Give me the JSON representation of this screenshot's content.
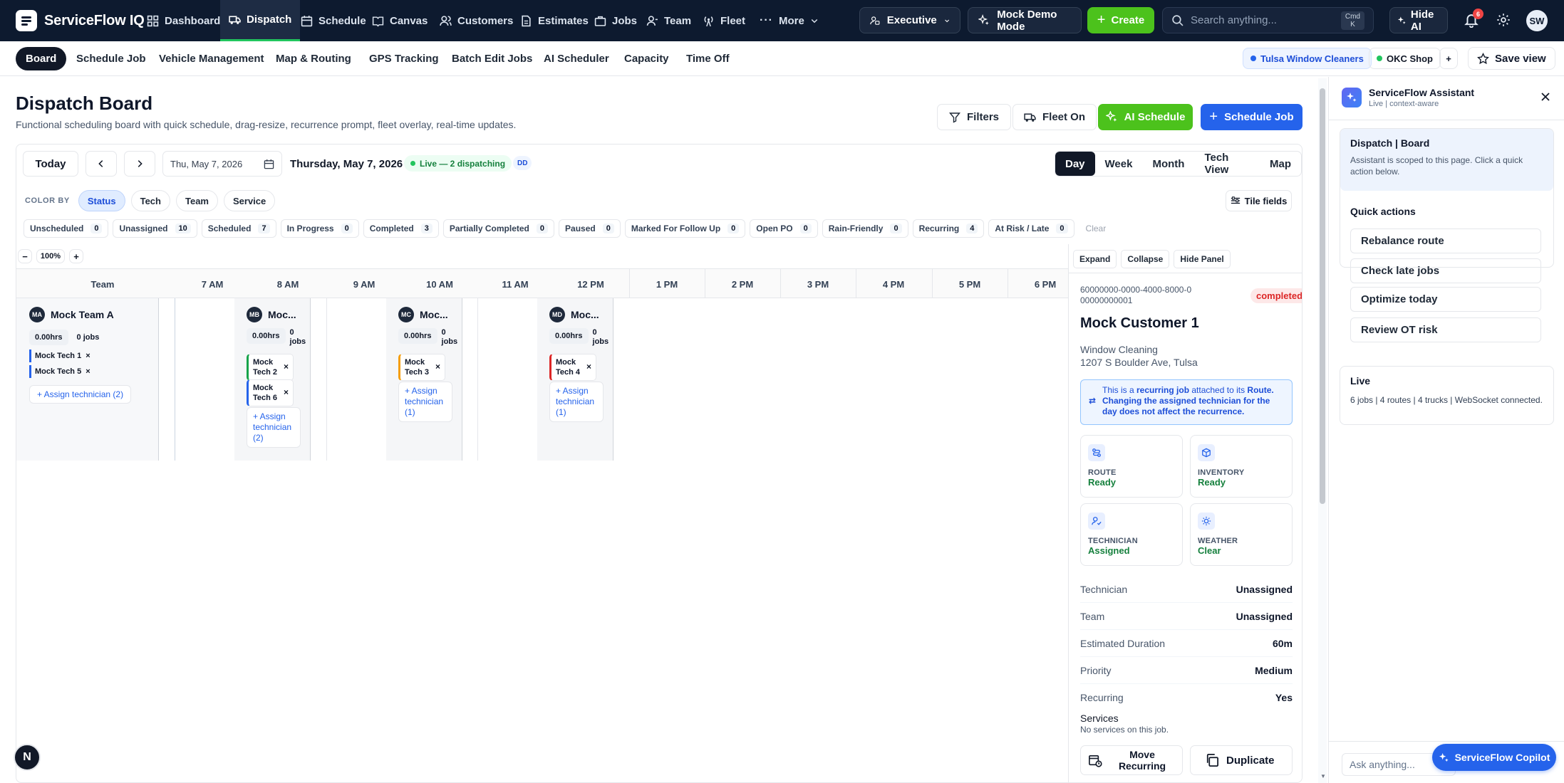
{
  "app": {
    "name": "ServiceFlow IQ"
  },
  "topnav": {
    "items": [
      {
        "label": "Dashboard"
      },
      {
        "label": "Dispatch"
      },
      {
        "label": "Schedule"
      },
      {
        "label": "Canvas"
      },
      {
        "label": "Customers"
      },
      {
        "label": "Estimates"
      },
      {
        "label": "Jobs"
      },
      {
        "label": "Team"
      },
      {
        "label": "Fleet"
      },
      {
        "label": "More"
      }
    ],
    "role": "Executive",
    "demo_mode": "Mock Demo Mode",
    "create": "Create",
    "search_placeholder": "Search anything...",
    "search_kbd_1": "Cmd",
    "search_kbd_2": "K",
    "hide_ai": "Hide AI",
    "notifications": "6",
    "avatar": "SW"
  },
  "subnav": {
    "items": [
      {
        "label": "Board"
      },
      {
        "label": "Schedule Job"
      },
      {
        "label": "Vehicle Management"
      },
      {
        "label": "Map & Routing"
      },
      {
        "label": "GPS Tracking"
      },
      {
        "label": "Batch Edit Jobs"
      },
      {
        "label": "AI Scheduler"
      },
      {
        "label": "Capacity"
      },
      {
        "label": "Time Off"
      }
    ],
    "org1": "Tulsa Window Cleaners",
    "org2": "OKC Shop",
    "plus": "+",
    "save_view": "Save view"
  },
  "header": {
    "title": "Dispatch Board",
    "subtitle": "Functional scheduling board with quick schedule, drag-resize, recurrence prompt, fleet overlay, real-time updates.",
    "filters": "Filters",
    "fleet": "Fleet On",
    "ai_schedule": "AI Schedule",
    "schedule_job": "Schedule Job"
  },
  "board": {
    "today": "Today",
    "date_input": "Thu, May 7, 2026",
    "date_long": "Thursday, May 7, 2026",
    "live": "Live — 2 dispatching",
    "dd": "DD",
    "views": [
      {
        "label": "Day"
      },
      {
        "label": "Week"
      },
      {
        "label": "Month"
      },
      {
        "label": "Tech View"
      },
      {
        "label": "Map"
      }
    ],
    "color_by_label": "COLOR BY",
    "color_by": [
      {
        "label": "Status"
      },
      {
        "label": "Tech"
      },
      {
        "label": "Team"
      },
      {
        "label": "Service"
      }
    ],
    "tile_fields": "Tile fields",
    "statuses": [
      {
        "label": "Unscheduled",
        "count": "0"
      },
      {
        "label": "Unassigned",
        "count": "10"
      },
      {
        "label": "Scheduled",
        "count": "7"
      },
      {
        "label": "In Progress",
        "count": "0"
      },
      {
        "label": "Completed",
        "count": "3"
      },
      {
        "label": "Partially Completed",
        "count": "0"
      },
      {
        "label": "Paused",
        "count": "0"
      },
      {
        "label": "Marked For Follow Up",
        "count": "0"
      },
      {
        "label": "Open PO",
        "count": "0"
      },
      {
        "label": "Rain-Friendly",
        "count": "0"
      },
      {
        "label": "Recurring",
        "count": "4"
      },
      {
        "label": "At Risk / Late",
        "count": "0"
      }
    ],
    "clear": "Clear",
    "zoom": "100%",
    "zoom_minus": "−",
    "zoom_plus": "+",
    "team_header": "Team",
    "hours": [
      "7 AM",
      "8 AM",
      "9 AM",
      "10 AM",
      "11 AM",
      "12 PM",
      "1 PM",
      "2 PM",
      "3 PM",
      "4 PM",
      "5 PM",
      "6 PM"
    ],
    "team_a": {
      "initials": "MA",
      "name": "Mock Team A",
      "hours": "0.00hrs",
      "jobs": "0 jobs",
      "techs": [
        "Mock Tech 1",
        "Mock Tech 5"
      ],
      "assign": "+ Assign technician (2)"
    },
    "team_b": {
      "initials": "MB",
      "name": "Moc...",
      "hours": "0.00hrs",
      "jobs": "0 jobs",
      "tech1": "Mock Tech 2",
      "tech2": "Mock Tech 6",
      "assign": "+ Assign technician (2)"
    },
    "team_c": {
      "initials": "MC",
      "name": "Moc...",
      "hours": "0.00hrs",
      "jobs": "0 jobs",
      "tech1": "Mock Tech 3",
      "assign": "+ Assign technician (1)"
    },
    "team_d": {
      "initials": "MD",
      "name": "Moc...",
      "hours": "0.00hrs",
      "jobs": "0 jobs",
      "tech1": "Mock Tech 4",
      "assign": "+ Assign technician (1)"
    }
  },
  "detail": {
    "expand": "Expand",
    "collapse": "Collapse",
    "hide": "Hide Panel",
    "job_id": "60000000-0000-4000-8000-000000000001",
    "status": "completed",
    "customer": "Mock Customer 1",
    "service": "Window Cleaning",
    "address": "1207 S Boulder Ave, Tulsa",
    "notice_pre": "This is a ",
    "notice_bold": "recurring job",
    "notice_mid": " attached to its ",
    "notice_bold2": "Route",
    "notice_post": ". Changing the assigned technician for the day does not affect the recurrence.",
    "cards": [
      {
        "title": "ROUTE",
        "value": "Ready"
      },
      {
        "title": "INVENTORY",
        "value": "Ready"
      },
      {
        "title": "TECHNICIAN",
        "value": "Assigned"
      },
      {
        "title": "WEATHER",
        "value": "Clear"
      }
    ],
    "fields": [
      {
        "k": "Technician",
        "v": "Unassigned"
      },
      {
        "k": "Team",
        "v": "Unassigned"
      },
      {
        "k": "Estimated Duration",
        "v": "60m"
      },
      {
        "k": "Priority",
        "v": "Medium"
      },
      {
        "k": "Recurring",
        "v": "Yes"
      }
    ],
    "services_label": "Services",
    "services_empty": "No services on this job.",
    "move_recurring": "Move Recurring",
    "duplicate": "Duplicate"
  },
  "assistant": {
    "title": "ServiceFlow Assistant",
    "subtitle": "Live | context-aware",
    "context_title": "Dispatch | Board",
    "context_text": "Assistant is scoped to this page. Click a quick action below.",
    "quick_actions_label": "Quick actions",
    "actions": [
      {
        "label": "Rebalance route"
      },
      {
        "label": "Check late jobs"
      },
      {
        "label": "Optimize today"
      },
      {
        "label": "Review OT risk"
      }
    ],
    "live_label": "Live",
    "live_text": "6 jobs | 4 routes | 4 trucks | WebSocket connected.",
    "ask_placeholder": "Ask anything...",
    "copilot": "ServiceFlow Copilot"
  },
  "floating": {
    "badge": "N"
  },
  "colors": {
    "nav_bg": "#0d1a2f",
    "green": "#4cc21c",
    "blue": "#2563eb",
    "completed_red": "#dc2626"
  }
}
